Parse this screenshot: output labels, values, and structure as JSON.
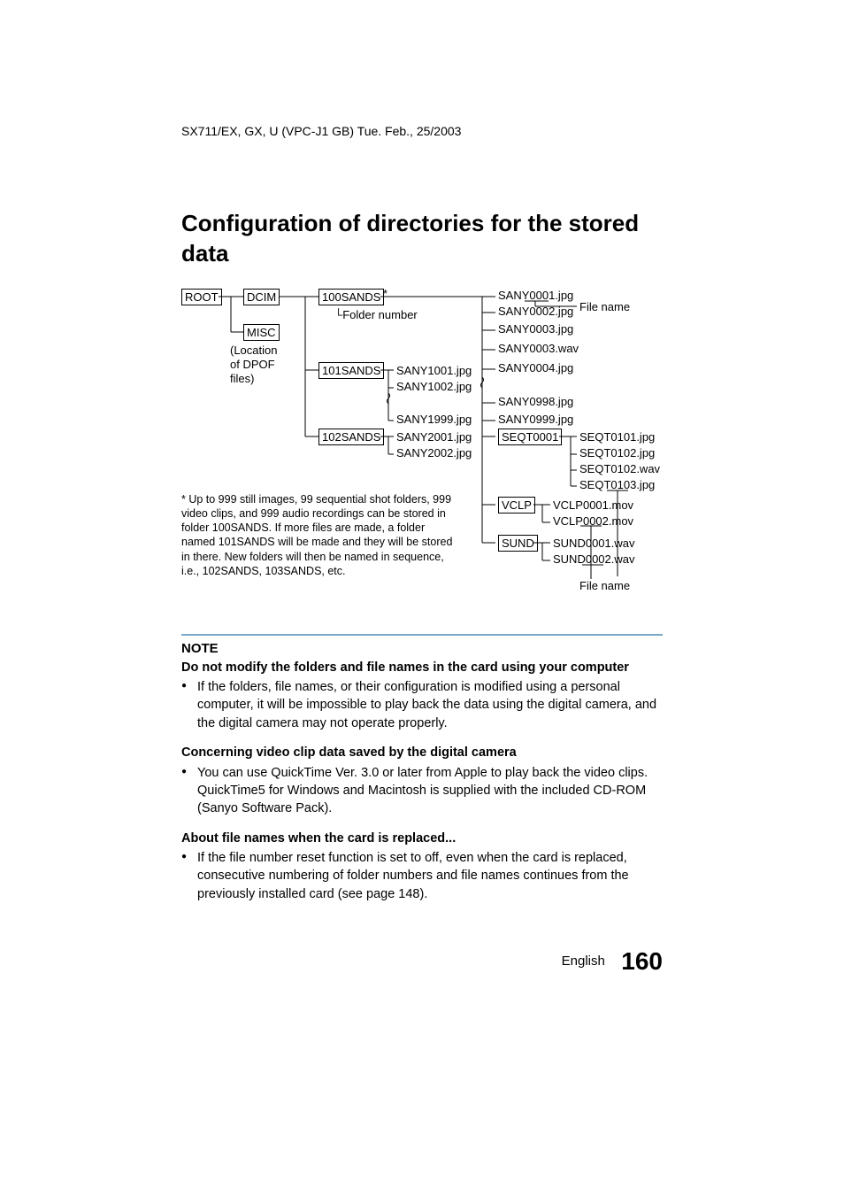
{
  "header": "SX711/EX, GX, U (VPC-J1 GB)    Tue. Feb., 25/2003",
  "title": "Configuration of directories for the stored data",
  "diagram": {
    "root": "ROOT",
    "dcim": "DCIM",
    "misc": "MISC",
    "misc_note_l1": "(Location",
    "misc_note_l2": "of DPOF",
    "misc_note_l3": "files)",
    "f100": "100SANDS",
    "f101": "101SANDS",
    "f102": "102SANDS",
    "star": "*",
    "folder_num_label": "Folder number",
    "f101_files": [
      "SANY1001.jpg",
      "SANY1002.jpg",
      "SANY1999.jpg"
    ],
    "f102_files": [
      "SANY2001.jpg",
      "SANY2002.jpg"
    ],
    "sany_files": [
      "SANY0001.jpg",
      "SANY0002.jpg",
      "SANY0003.jpg",
      "SANY0003.wav",
      "SANY0004.jpg",
      "SANY0998.jpg",
      "SANY0999.jpg"
    ],
    "seqt_box": "SEQT0001",
    "seqt_files": [
      "SEQT0101.jpg",
      "SEQT0102.jpg",
      "SEQT0102.wav",
      "SEQT0103.jpg"
    ],
    "vclp_box": "VCLP",
    "vclp_files": [
      "VCLP0001.mov",
      "VCLP0002.mov"
    ],
    "sund_box": "SUND",
    "sund_files": [
      "SUND0001.wav",
      "SUND0002.wav"
    ],
    "file_name_label_top": "File name",
    "file_name_label_bottom": "File name"
  },
  "footnote": "* Up to 999 still images, 99 sequential shot folders, 999 video clips, and 999 audio recordings can be stored in folder 100SANDS. If more files are made, a folder named 101SANDS will be made and they will be stored in there. New folders will then be named in sequence, i.e., 102SANDS, 103SANDS, etc.",
  "note": {
    "heading": "NOTE",
    "sub1": "Do not modify the folders and file names in the card using your computer",
    "b1": "If the folders, file names, or their configuration is modified using a personal computer, it will be impossible to play back the data using the digital camera, and the digital camera may not operate properly.",
    "sub2": "Concerning video clip data saved by the digital camera",
    "b2a": "You can use QuickTime Ver. 3.0 or later from Apple to play back the video clips.",
    "b2b": "QuickTime5 for Windows and Macintosh is supplied with the included CD-ROM (Sanyo Software Pack).",
    "sub3": "About file names when the card is replaced...",
    "b3": "If the file number reset function is set to off, even when the card is replaced, consecutive numbering of folder numbers and file names continues from the previously installed card (see page 148)."
  },
  "footer": {
    "lang": "English",
    "page": "160"
  }
}
